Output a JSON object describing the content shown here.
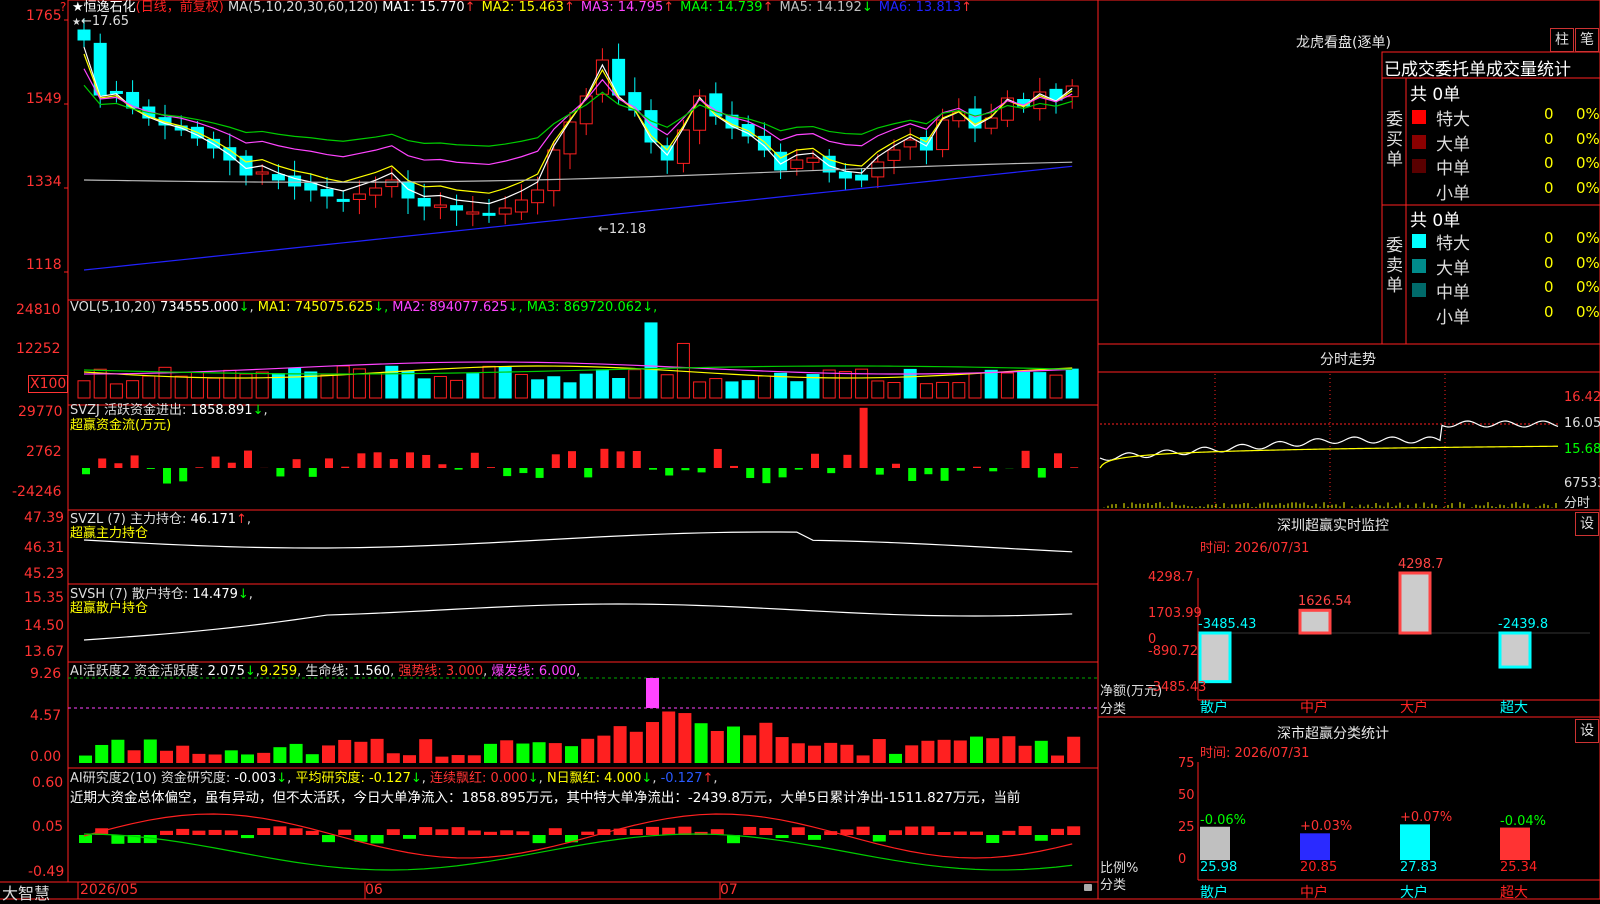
{
  "stock": {
    "name": "恒逸石化",
    "period": "(日线，前复权)",
    "ma_label": "MA(5,10,20,30,60,120)",
    "ma_values": [
      {
        "label": "MA1:",
        "value": "15.770",
        "dir": "↑",
        "color": "#ffffff"
      },
      {
        "label": "MA2:",
        "value": "15.463",
        "dir": "↑",
        "color": "#ffff00"
      },
      {
        "label": "MA3:",
        "value": "14.795",
        "dir": "↑",
        "color": "#ff44ff"
      },
      {
        "label": "MA4:",
        "value": "14.739",
        "dir": "↑",
        "color": "#00ff00"
      },
      {
        "label": "MA5:",
        "value": "14.192",
        "dir": "↓",
        "color": "#c0c0c0"
      },
      {
        "label": "MA6:",
        "value": "13.813",
        "dir": "↑",
        "color": "#2222ff"
      }
    ],
    "high_marker": "←17.65",
    "low_marker": "←12.18",
    "question": "?",
    "star": "★"
  },
  "price_axis": [
    "1765",
    "1549",
    "1334",
    "1118"
  ],
  "vol": {
    "title": "VOL(5,10,20)",
    "value": "734555.000",
    "items": [
      {
        "label": "MA1:",
        "value": "745075.625",
        "dir": "↓",
        "color": "#ffff00"
      },
      {
        "label": "MA2:",
        "value": "894077.625",
        "dir": "↓",
        "color": "#ff44ff"
      },
      {
        "label": "MA3:",
        "value": "869720.062",
        "dir": "↓",
        "color": "#00ff00"
      }
    ],
    "axis": [
      "24810",
      "12252"
    ],
    "unit": "X100"
  },
  "svzj": {
    "title": "SVZJ  活跃资金进出:",
    "value": "1858.891",
    "sub": "超赢资金流(万元)",
    "axis": [
      "29770",
      "2762",
      "-24246"
    ]
  },
  "svzl": {
    "title": "SVZL (7) 主力持仓:",
    "value": "46.171",
    "sub": "超赢主力持仓",
    "axis": [
      "47.39",
      "46.31",
      "45.23"
    ]
  },
  "svsh": {
    "title": "SVSH (7) 散户持仓:",
    "value": "14.479",
    "sub": "超赢散户持仓",
    "axis": [
      "15.35",
      "14.50",
      "13.67"
    ]
  },
  "ai1": {
    "title": "AI活跃度2 资金活跃度:",
    "v1": "2.075",
    "v2": "9.259",
    "life_label": "生命线:",
    "life": "1.560",
    "strong": "强势线: 3.000",
    "burst": "爆发线: 6.000",
    "axis": [
      "9.26",
      "4.57",
      "0.00"
    ]
  },
  "ai2": {
    "title": "AI研究度2(10) 资金研究度:",
    "v1": "-0.003",
    "avg": "平均研究度: -0.127",
    "lianxu": "连续飘红: 0.000",
    "nri": "N日飘红: 4.000",
    "last": "-0.127",
    "desc": "近期大资金总体偏空，虽有异动，但不太活跃，今日大单净流入：1858.895万元，其中特大单净流出：-2439.8万元，大单5日累计净出-1511.827万元，当前",
    "axis": [
      "0.60",
      "0.05",
      "-0.49"
    ]
  },
  "dates": [
    "2026/05",
    "06",
    "07"
  ],
  "brand": "大智慧",
  "right": {
    "lhb_title": "龙虎看盘(逐单)",
    "tab_zhu": "柱",
    "tab_bi": "笔",
    "headers": "已成交委托单成交量统计",
    "buy_label": "委买单",
    "sell_label": "委卖单",
    "buy_total": "共 0单",
    "sell_total": "共 0单",
    "buy_rows": [
      {
        "name": "特大",
        "count": "0",
        "pct": "0%",
        "color": "#ff0000"
      },
      {
        "name": "大单",
        "count": "0",
        "pct": "0%",
        "color": "#8b0000"
      },
      {
        "name": "中单",
        "count": "0",
        "pct": "0%",
        "color": "#5a0000"
      },
      {
        "name": "小单",
        "count": "0",
        "pct": "0%",
        "color": "#000000"
      }
    ],
    "sell_rows": [
      {
        "name": "特大",
        "count": "0",
        "pct": "0%",
        "color": "#00ffff"
      },
      {
        "name": "大单",
        "count": "0",
        "pct": "0%",
        "color": "#008b8b"
      },
      {
        "name": "中单",
        "count": "0",
        "pct": "0%",
        "color": "#006a6a"
      },
      {
        "name": "小单",
        "count": "0",
        "pct": "0%",
        "color": "#000000"
      }
    ],
    "fs_title": "分时走势",
    "fs_axis": [
      "16.42",
      "16.05",
      "15.68",
      "67533"
    ],
    "fs_unit": "分时",
    "sz_title": "深圳超赢实时监控",
    "sz_set": "设",
    "sz_time": "时间: 2026/07/31",
    "sz_axis": [
      "4298.7",
      "1703.99",
      "0",
      "-890.72",
      "-3485.43"
    ],
    "sz_net": "净额(万元)",
    "sz_class": "分类",
    "sz_bars": [
      {
        "cat": "散户",
        "value": -3485.43,
        "label": "-3485.43",
        "color": "#00ffff",
        "cat_color": "#00ffff"
      },
      {
        "cat": "中户",
        "value": 1626.54,
        "label": "1626.54",
        "color": "#ff4444",
        "cat_color": "#ff2222"
      },
      {
        "cat": "大户",
        "value": 4298.7,
        "label": "4298.7",
        "color": "#ff4444",
        "cat_color": "#ff2222"
      },
      {
        "cat": "超大",
        "value": -2439.8,
        "label": "-2439.8",
        "color": "#00ffff",
        "cat_color": "#00ffff"
      }
    ],
    "sc_title": "深市超赢分类统计",
    "sc_set": "设",
    "sc_time": "时间: 2026/07/31",
    "sc_axis": [
      "75",
      "50",
      "25",
      "0"
    ],
    "sc_ratio": "比例%",
    "sc_class": "分类",
    "sc_bars": [
      {
        "cat": "散户",
        "value": 25.98,
        "change": "-0.06%",
        "change_color": "#00ff00",
        "bar": "#c0c0c0",
        "cat_color": "#00ffff"
      },
      {
        "cat": "中户",
        "value": 20.85,
        "change": "+0.03%",
        "change_color": "#ff3333",
        "bar": "#2a2aff",
        "cat_color": "#ff2222"
      },
      {
        "cat": "大户",
        "value": 27.83,
        "change": "+0.07%",
        "change_color": "#ff3333",
        "bar": "#00ffff",
        "cat_color": "#00ffff"
      },
      {
        "cat": "超大",
        "value": 25.34,
        "change": "-0.04%",
        "change_color": "#00ff00",
        "bar": "#ff3333",
        "cat_color": "#ff2222"
      }
    ]
  }
}
